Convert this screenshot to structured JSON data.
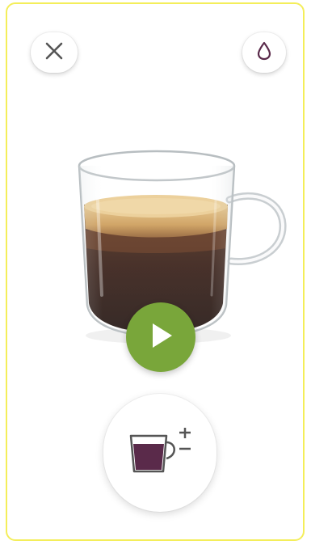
{
  "colors": {
    "frame_border": "#f4ee5a",
    "play_button": "#79a63a",
    "accent_purple": "#5a2a4a",
    "icon_gray": "#555555"
  },
  "icons": {
    "close": "close-icon",
    "water": "water-drop-icon",
    "cup": "coffee-cup-image",
    "play": "play-icon",
    "volume": "cup-volume-adjust-icon"
  }
}
